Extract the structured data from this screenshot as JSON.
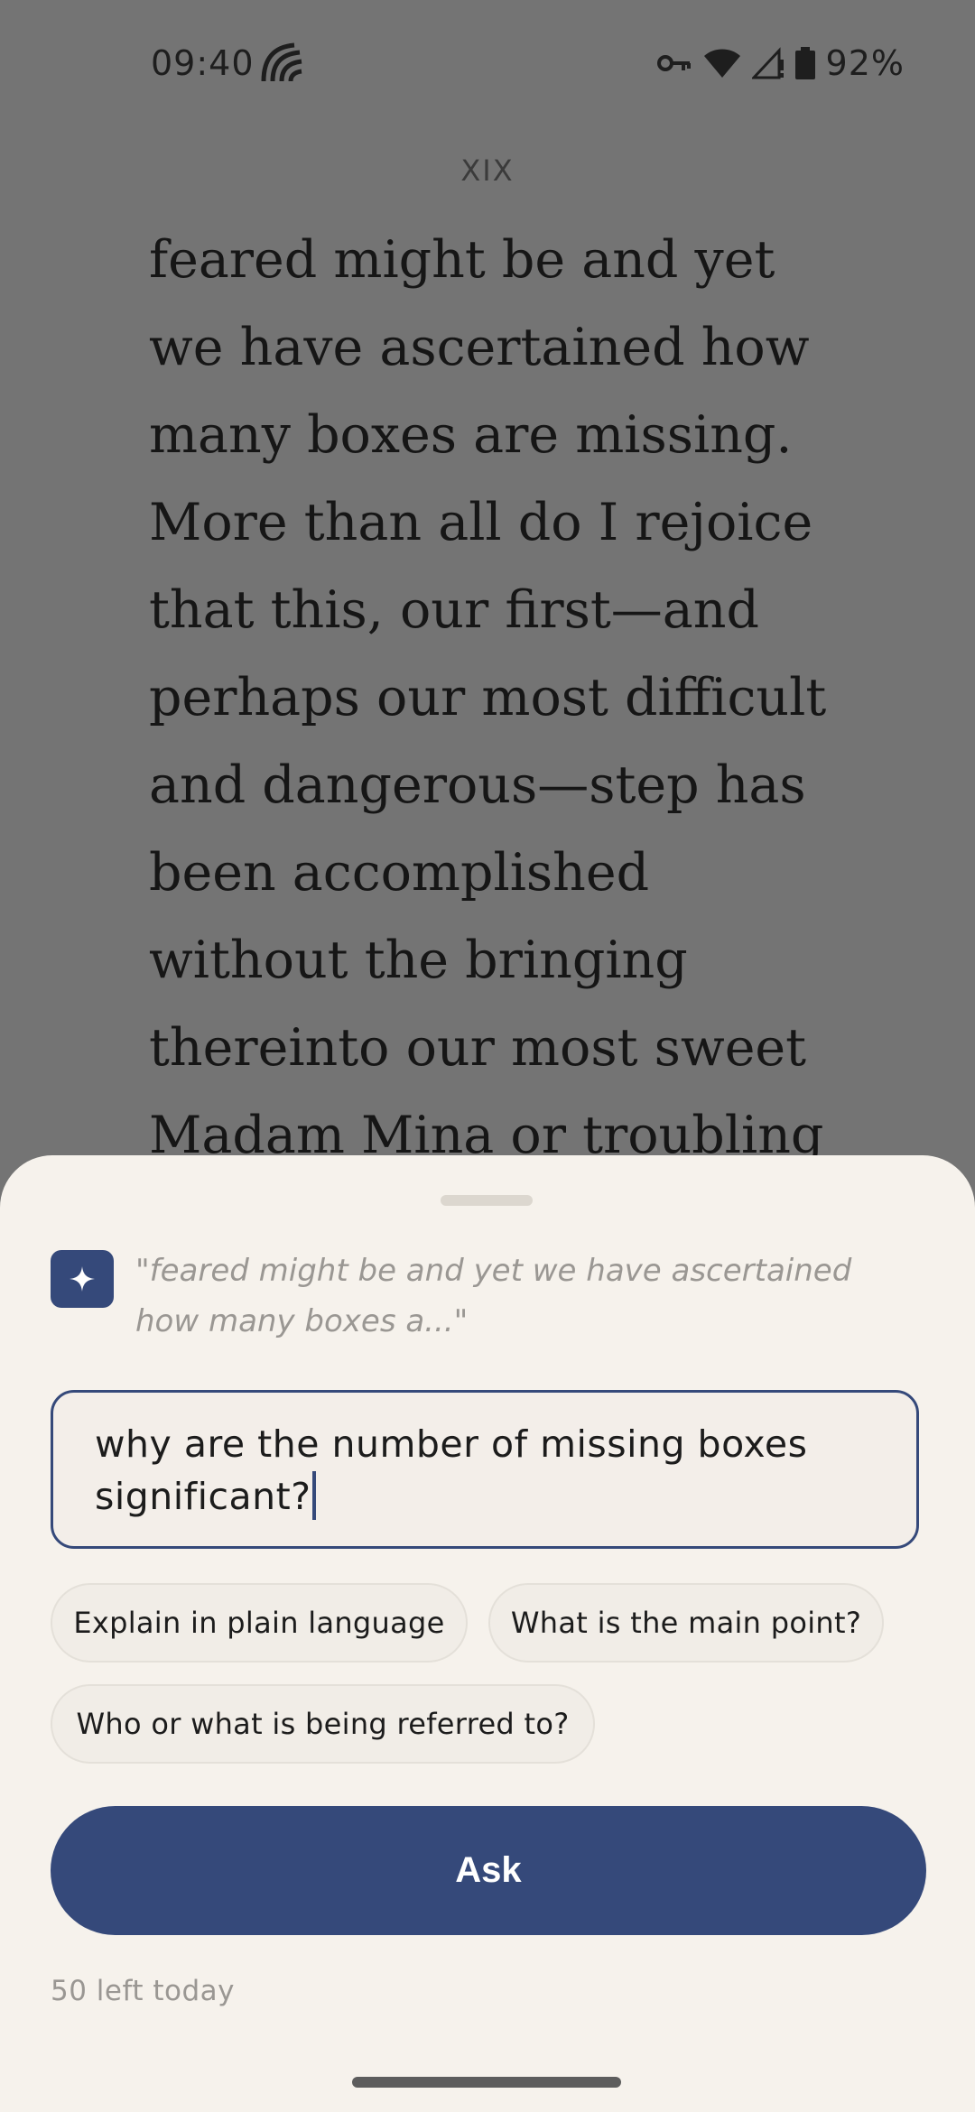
{
  "status_bar": {
    "time": "09:40",
    "battery_percent": "92%",
    "icons": [
      "app-notification-icon",
      "vpn-key-icon",
      "wifi-icon",
      "cellular-signal-icon",
      "battery-icon"
    ]
  },
  "reader": {
    "chapter": "XIX",
    "lines": [
      "feared might be and yet",
      "we have ascertained how",
      "many boxes are missing.",
      "More than all do I rejoice",
      "that this, our first—and",
      "perhaps our most difficult",
      "and dangerous—step has",
      "been accomplished",
      "without the bringing",
      "thereinto our most sweet",
      "Madam Mina or troubling"
    ]
  },
  "ask_sheet": {
    "icon": "sparkle-icon",
    "quote_line1": "\"feared might be and yet we have ascertained",
    "quote_line2": "how many boxes a...\"",
    "question_line1": "why are the number of missing boxes",
    "question_line2": "significant?",
    "suggestions": [
      "Explain in plain language",
      "What is the main point?",
      "Who or what is being referred to?"
    ],
    "ask_label": "Ask",
    "quota_text": "50 left today"
  },
  "colors": {
    "accent": "#35497a",
    "sheet_background": "#f6f2ec",
    "dimmed_page": "#747474"
  }
}
